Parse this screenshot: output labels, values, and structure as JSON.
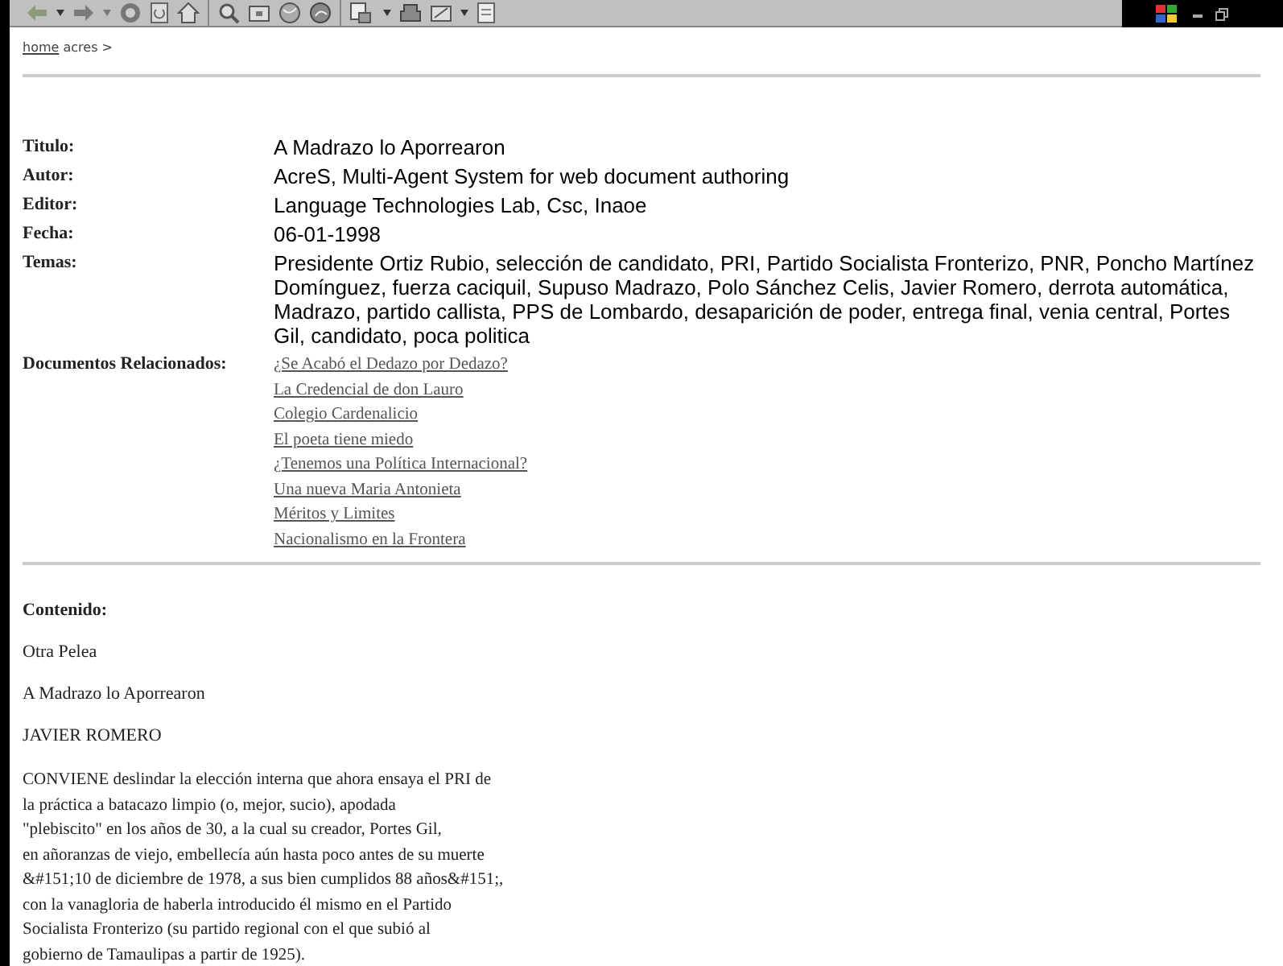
{
  "breadcrumb": {
    "link": "home",
    "rest": "acres >"
  },
  "fields": [
    {
      "label": "Titulo:",
      "value": "A Madrazo lo Aporrearon"
    },
    {
      "label": "Autor:",
      "value": "AcreS, Multi-Agent System for web document authoring"
    },
    {
      "label": "Editor:",
      "value": "Language Technologies Lab, Csc, Inaoe"
    },
    {
      "label": "Fecha:",
      "value": "06-01-1998"
    },
    {
      "label": "Temas:",
      "value": "Presidente Ortiz Rubio, selección de candidato, PRI, Partido Socialista Fronterizo, PNR, Poncho Martínez Domínguez, fuerza caciquil, Supuso Madrazo, Polo Sánchez Celis, Javier Romero, derrota automática, Madrazo, partido callista, PPS de Lombardo, desaparición de poder, entrega final, venia central, Portes Gil, candidato, poca politica"
    }
  ],
  "related": {
    "label": "Documentos Relacionados:",
    "links": [
      "¿Se Acabó el Dedazo por Dedazo?",
      "La Credencial de don Lauro",
      "Colegio Cardenalicio",
      "El poeta tiene miedo",
      "¿Tenemos una Política Internacional?",
      "Una nueva Maria Antonieta",
      "Méritos y Limites",
      "Nacionalismo en la Frontera"
    ]
  },
  "content": {
    "label": "Contenido:",
    "paragraphs": [
      "Otra Pelea",
      "A Madrazo lo Aporrearon",
      "JAVIER ROMERO"
    ],
    "body_lines": [
      "CONVIENE deslindar la elección interna que ahora ensaya el PRI de",
      "la práctica a batacazo limpio (o, mejor, sucio), apodada",
      "\"plebiscito\" en los años de 30, a la cual su creador, Portes Gil,",
      "en añoranzas de viejo, embellecía aún hasta poco antes de su muerte",
      "&#151;10 de diciembre de 1978, a sus bien cumplidos 88 años&#151;,",
      "con la vanagloria de haberla introducido él mismo en el Partido",
      "Socialista Fronterizo (su partido regional con el que subió al",
      "gobierno de Tamaulipas a partir de 1925)."
    ]
  }
}
